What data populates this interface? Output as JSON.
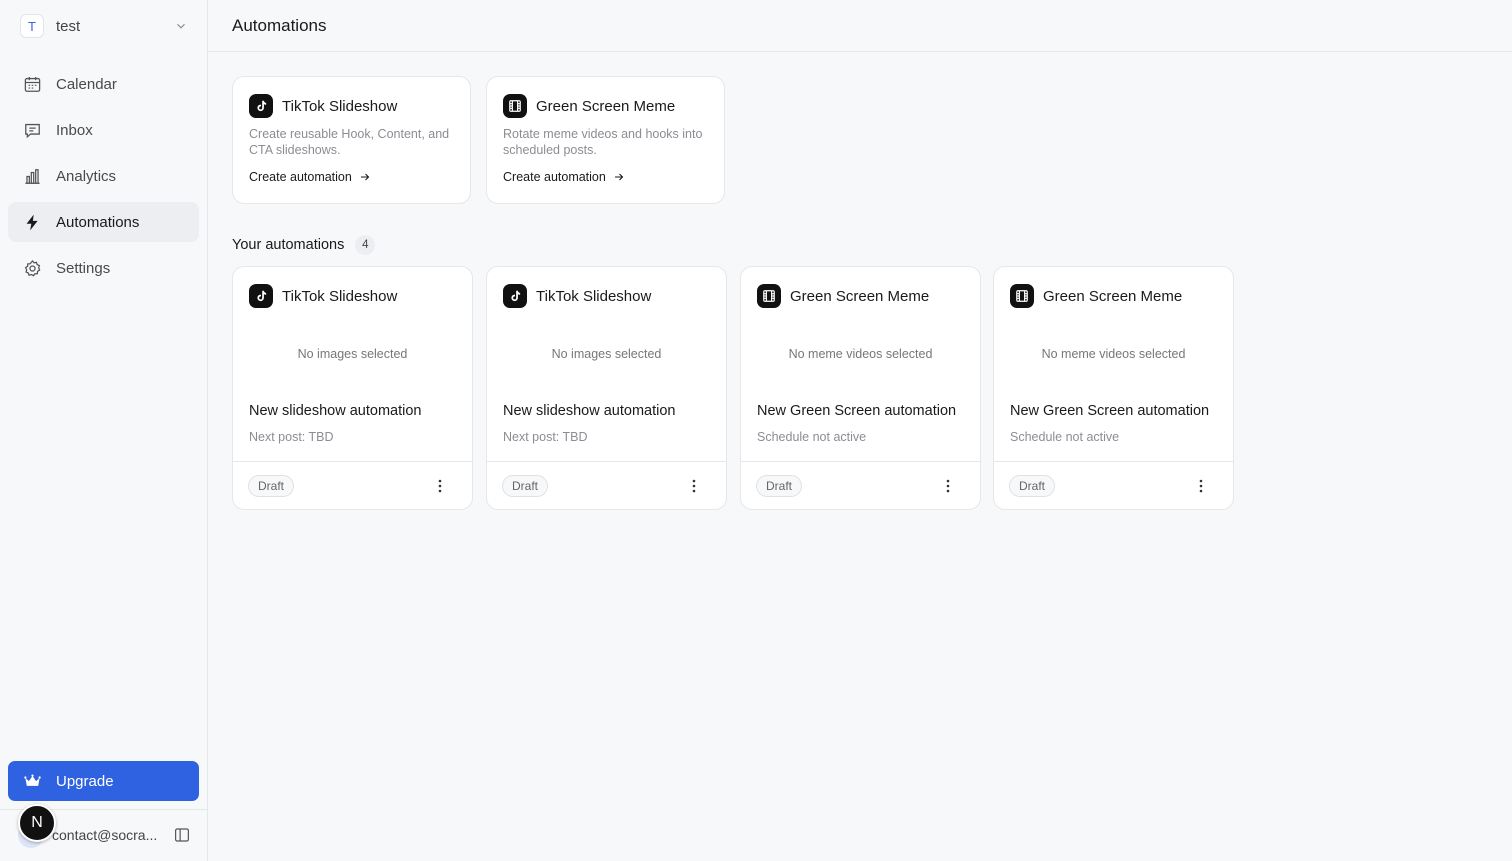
{
  "workspace": {
    "initial": "T",
    "name": "test"
  },
  "nav": [
    {
      "label": "Calendar",
      "icon": "calendar-icon"
    },
    {
      "label": "Inbox",
      "icon": "inbox-icon"
    },
    {
      "label": "Analytics",
      "icon": "analytics-icon"
    },
    {
      "label": "Automations",
      "icon": "lightning-icon",
      "active": true
    },
    {
      "label": "Settings",
      "icon": "gear-icon"
    }
  ],
  "upgrade": {
    "label": "Upgrade",
    "icon": "crown-icon"
  },
  "user": {
    "email": "contact@socra...",
    "badge": "N"
  },
  "page": {
    "title": "Automations"
  },
  "templates": [
    {
      "title": "TikTok Slideshow",
      "icon": "tiktok-icon",
      "description": "Create reusable Hook, Content, and CTA slideshows.",
      "link": "Create automation"
    },
    {
      "title": "Green Screen Meme",
      "icon": "film-icon",
      "description": "Rotate meme videos and hooks into scheduled posts.",
      "link": "Create automation"
    }
  ],
  "your_automations": {
    "label": "Your automations",
    "count": "4",
    "items": [
      {
        "type": "TikTok Slideshow",
        "icon": "tiktok-icon",
        "empty": "No images selected",
        "name": "New slideshow automation",
        "sub": "Next post: TBD",
        "status": "Draft"
      },
      {
        "type": "TikTok Slideshow",
        "icon": "tiktok-icon",
        "empty": "No images selected",
        "name": "New slideshow automation",
        "sub": "Next post: TBD",
        "status": "Draft"
      },
      {
        "type": "Green Screen Meme",
        "icon": "film-icon",
        "empty": "No meme videos selected",
        "name": "New Green Screen automation",
        "sub": "Schedule not active",
        "status": "Draft"
      },
      {
        "type": "Green Screen Meme",
        "icon": "film-icon",
        "empty": "No meme videos selected",
        "name": "New Green Screen automation",
        "sub": "Schedule not active",
        "status": "Draft"
      }
    ]
  },
  "colors": {
    "accent": "#2f62e0",
    "active_bg": "#eceef1",
    "border": "#e6e7ea"
  }
}
